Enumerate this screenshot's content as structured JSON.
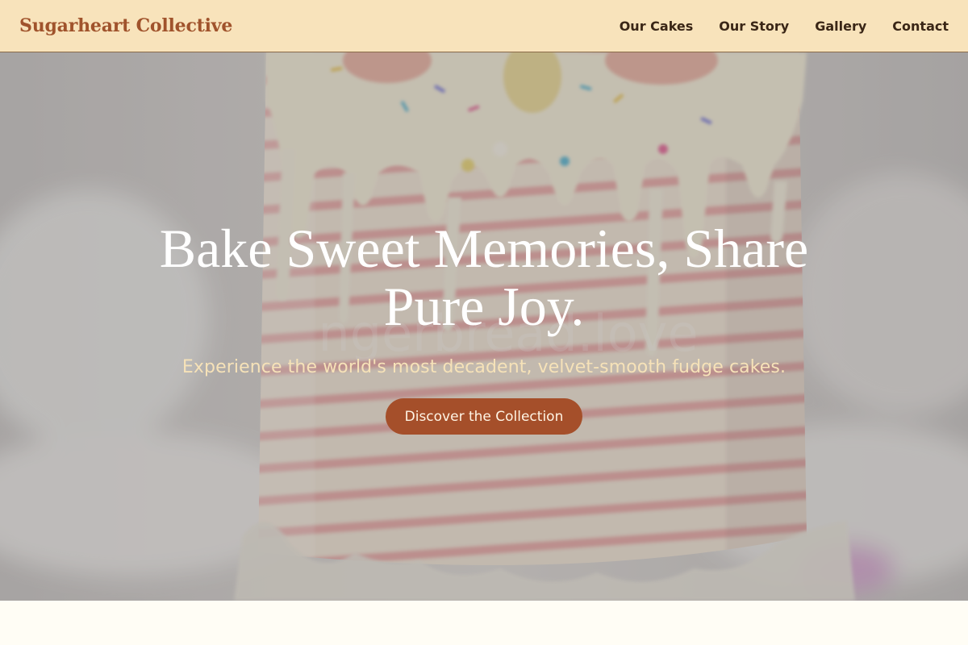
{
  "header": {
    "brand": "Sugarheart Collective",
    "nav": [
      "Our Cakes",
      "Our Story",
      "Gallery",
      "Contact"
    ]
  },
  "hero": {
    "title": "Bake Sweet Memories, Share Pure Joy.",
    "subtitle": "Experience the world's most decadent, velvet-smooth fudge cakes.",
    "cta_label": "Discover the Collection",
    "watermark": "ngerbread.love"
  },
  "colors": {
    "header_bg": "#f8e3bb",
    "brand": "#a0532c",
    "cta_bg": "#a54f2a",
    "subtitle": "#f6e2b8"
  }
}
